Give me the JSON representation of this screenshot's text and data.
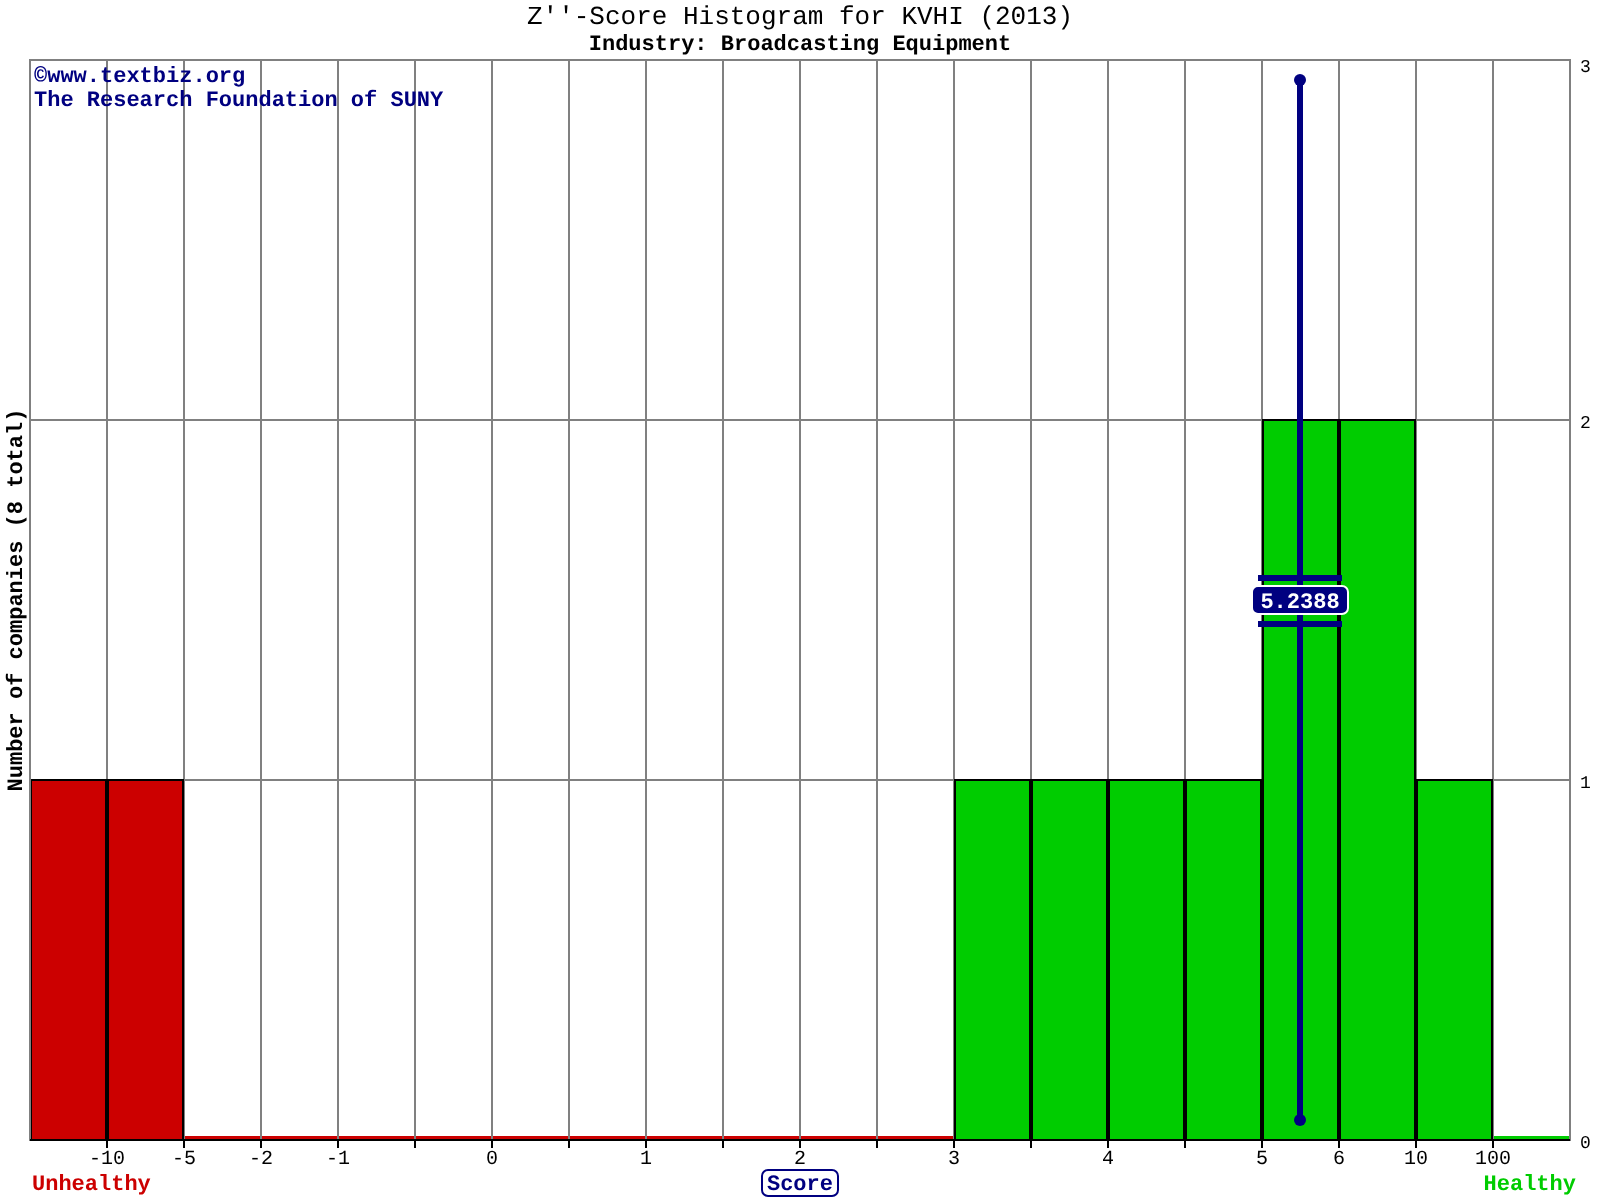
{
  "header": {
    "title": "Z''-Score Histogram for KVHI (2013)",
    "subtitle": "Industry: Broadcasting Equipment"
  },
  "credits": [
    "©www.textbiz.org",
    "The Research Foundation of SUNY"
  ],
  "chart_data": {
    "type": "bar",
    "xlabel": "Score",
    "ylabel": "Number of companies (8 total)",
    "categories": [
      null,
      "-10",
      "-5",
      "-2",
      "-1",
      null,
      "0",
      null,
      "1",
      null,
      "2",
      null,
      "3",
      null,
      "4",
      null,
      "5",
      "6",
      "10",
      "100"
    ],
    "series": [
      {
        "name": "Unhealthy",
        "color": "#cc0000",
        "values": [
          1,
          1,
          0,
          0,
          0,
          0,
          0,
          0,
          0,
          0,
          0,
          0,
          null,
          null,
          null,
          null,
          null,
          null,
          null,
          null
        ]
      },
      {
        "name": "Healthy",
        "color": "#00cc00",
        "values": [
          null,
          null,
          null,
          null,
          null,
          null,
          null,
          null,
          null,
          null,
          null,
          null,
          1,
          1,
          1,
          1,
          2,
          2,
          1,
          0
        ]
      }
    ],
    "yticks": [
      0,
      1,
      2,
      3
    ],
    "ylim": [
      0,
      3
    ],
    "grid": true,
    "annotations": [
      "5.2388"
    ]
  }
}
